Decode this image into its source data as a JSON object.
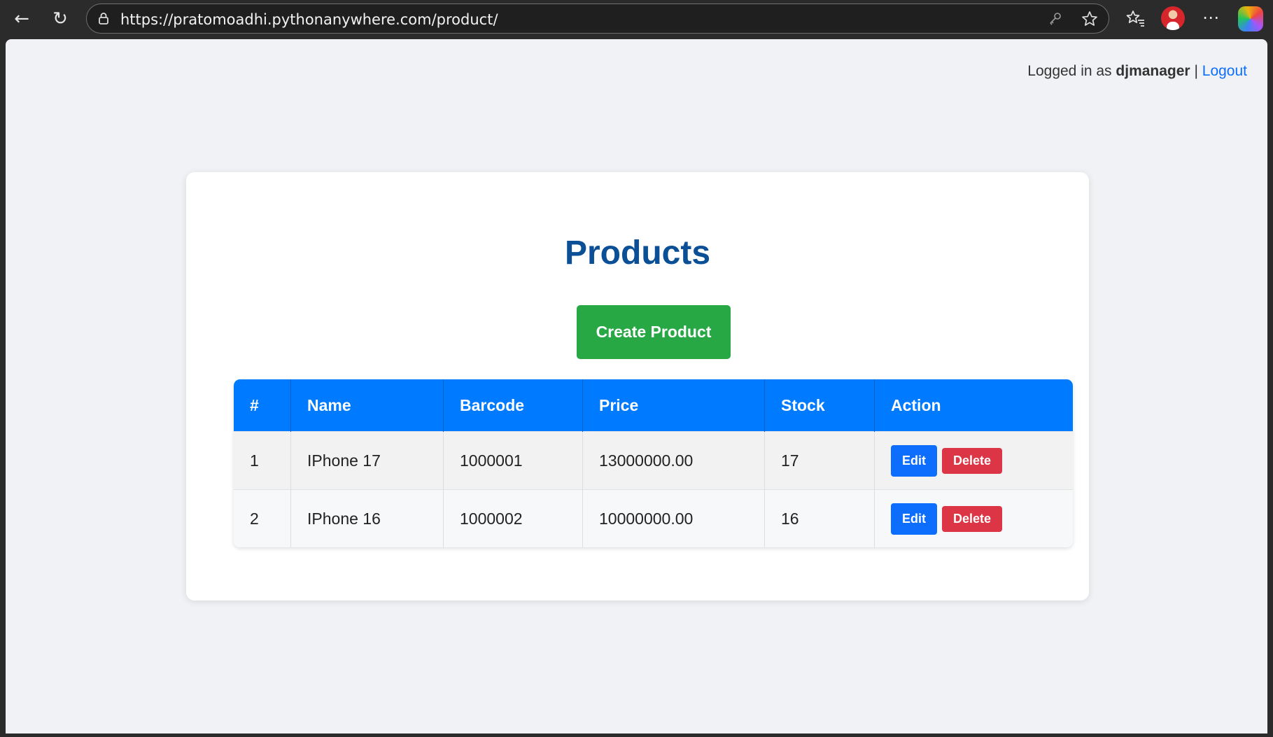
{
  "browser": {
    "url": "https://pratomoadhi.pythonanywhere.com/product/"
  },
  "header": {
    "logged_in_prefix": "Logged in as",
    "username": "djmanager",
    "separator": "|",
    "logout_label": "Logout"
  },
  "main": {
    "title": "Products",
    "create_button_label": "Create Product",
    "table": {
      "columns": [
        "#",
        "Name",
        "Barcode",
        "Price",
        "Stock",
        "Action"
      ],
      "rows": [
        {
          "num": "1",
          "name": "IPhone 17",
          "barcode": "1000001",
          "price": "13000000.00",
          "stock": "17",
          "edit_label": "Edit",
          "delete_label": "Delete"
        },
        {
          "num": "2",
          "name": "IPhone 16",
          "barcode": "1000002",
          "price": "10000000.00",
          "stock": "16",
          "edit_label": "Edit",
          "delete_label": "Delete"
        }
      ]
    }
  },
  "colors": {
    "title": "#0b4f96",
    "header_bg": "#007bff",
    "create_button": "#28a745",
    "edit_button": "#0d6efd",
    "delete_button": "#dc3545"
  }
}
